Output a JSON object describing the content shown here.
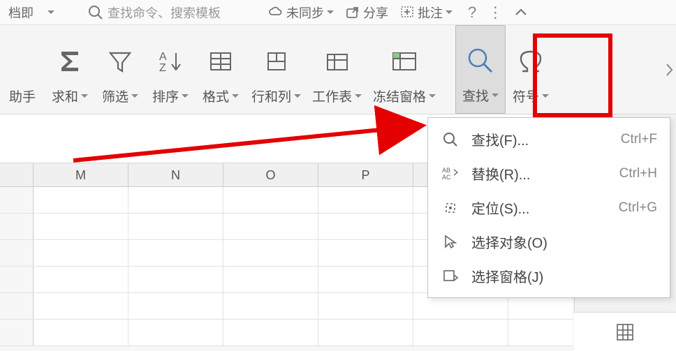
{
  "topbar": {
    "doc_frag": "档即",
    "search_placeholder": "查找命令、搜索模板",
    "sync": "未同步",
    "share": "分享",
    "annotate": "批注"
  },
  "ribbon": {
    "assistant": "助手",
    "sum": "求和",
    "filter": "筛选",
    "sort": "排序",
    "format": "格式",
    "rowcol": "行和列",
    "worksheet": "工作表",
    "freeze": "冻结窗格",
    "find": "查找",
    "symbol": "符号"
  },
  "menu": {
    "find": {
      "label": "查找(F)...",
      "shortcut": "Ctrl+F"
    },
    "replace": {
      "label": "替换(R)...",
      "shortcut": "Ctrl+H"
    },
    "goto": {
      "label": "定位(S)...",
      "shortcut": "Ctrl+G"
    },
    "select_objects": {
      "label": "选择对象(O)"
    },
    "select_pane": {
      "label": "选择窗格(J)"
    }
  },
  "columns": [
    "M",
    "N",
    "O",
    "P"
  ]
}
